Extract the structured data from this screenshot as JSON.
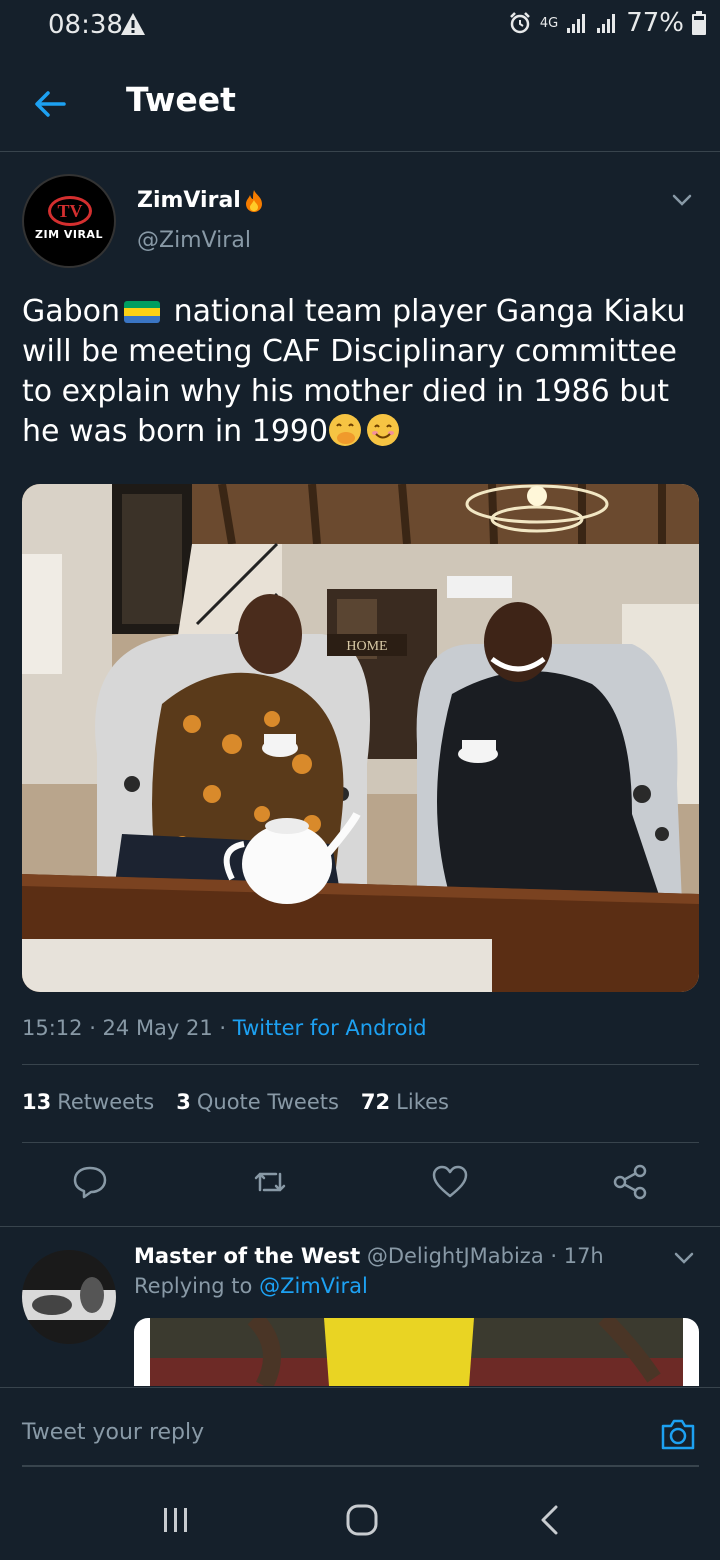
{
  "status": {
    "time": "08:38",
    "network": "4G",
    "battery": "77%"
  },
  "header": {
    "title": "Tweet"
  },
  "tweet": {
    "avatar_label": "ZIM VIRAL",
    "avatar_logo": "TV",
    "display_name": "ZimViral",
    "handle": "@ZimViral",
    "text_part1": "Gabon",
    "text_part2": " national team player  Ganga Kiaku will be meeting CAF Disciplinary committee to explain why his mother died in 1986 but he was born in 1990",
    "photo_sign": "HOME",
    "timestamp": "15:12 · 24 May 21 · ",
    "source": "Twitter for Android",
    "stats": {
      "retweets_count": "13",
      "retweets_label": "Retweets",
      "quotes_count": "3",
      "quotes_label": "Quote Tweets",
      "likes_count": "72",
      "likes_label": "Likes"
    }
  },
  "reply": {
    "name": "Master of the West",
    "handle_time": " @DelightJMabiza · 17h",
    "replying_prefix": "Replying to ",
    "replying_to": "@ZimViral"
  },
  "compose": {
    "placeholder": "Tweet your reply"
  },
  "icons": {
    "back": "arrow-left-icon",
    "reply": "comment-icon",
    "retweet": "retweet-icon",
    "like": "heart-icon",
    "share": "share-icon",
    "camera": "camera-icon"
  },
  "colors": {
    "background": "#15202b",
    "accent": "#1da1f2",
    "muted": "#8899a6",
    "divider": "#38444d"
  }
}
